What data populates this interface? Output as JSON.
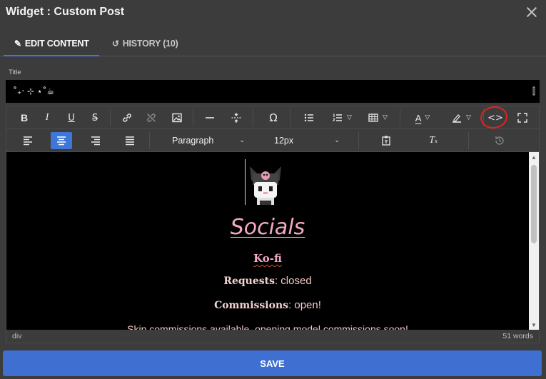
{
  "dialog": {
    "title": "Widget : Custom Post"
  },
  "tabs": [
    {
      "label": "EDIT CONTENT",
      "icon": "pencil-icon",
      "active": true
    },
    {
      "label": "HISTORY (10)",
      "icon": "history-icon",
      "active": false
    }
  ],
  "title_field": {
    "label": "Title",
    "value": "˚₊‧ ⊹ ⋆˚☕︎"
  },
  "toolbar": {
    "block_format": "Paragraph",
    "font_size": "12px",
    "icons_row1": [
      "bold-icon",
      "italic-icon",
      "underline-icon",
      "strikethrough-icon",
      "link-icon",
      "unlink-icon",
      "image-icon",
      "horizontal-rule-icon",
      "page-break-icon",
      "special-char-icon",
      "bullet-list-icon",
      "numbered-list-icon",
      "table-icon",
      "text-color-icon",
      "highlight-icon",
      "source-code-icon",
      "fullscreen-icon"
    ],
    "icons_row2": [
      "align-left-icon",
      "align-center-icon",
      "align-right-icon",
      "justify-icon",
      "paste-text-icon",
      "clear-format-icon",
      "revisions-icon"
    ]
  },
  "content": {
    "heading": "Socials",
    "kofi": "Ko-fi",
    "requests_label": "Requests",
    "requests_value": ": closed",
    "commissions_label": "Commissions",
    "commissions_value": ": open!",
    "skin_note": "Skin commissions available, opening model commissions soon!"
  },
  "status": {
    "path": "div",
    "word_count": "51 words"
  },
  "actions": {
    "save_label": "SAVE"
  },
  "colors": {
    "accent": "#3e77d9",
    "heading_pink": "#f3a9c4",
    "annotation_red": "#e0231f"
  }
}
